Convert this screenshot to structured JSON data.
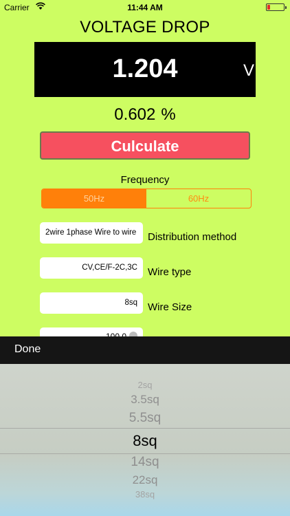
{
  "status_bar": {
    "carrier": "Carrier",
    "time": "11:44 AM"
  },
  "title": "VOLTAGE DROP",
  "display": {
    "value": "1.204",
    "unit": "V"
  },
  "percent": {
    "value": "0.602",
    "unit": "%"
  },
  "calculate_label": "Culculate",
  "frequency": {
    "label": "Frequency",
    "options": [
      "50Hz",
      "60Hz"
    ],
    "selected": "50Hz"
  },
  "distribution": {
    "value": "2wire 1phase Wire to wire",
    "label": "Distribution method"
  },
  "wire_type": {
    "value": "CV,CE/F-2C,3C",
    "label": "Wire type"
  },
  "wire_size": {
    "value": "8sq",
    "label": "Wire Size"
  },
  "length_value": "100.0",
  "toolbar": {
    "done_label": "Done"
  },
  "picker": {
    "options": [
      "2sq",
      "3.5sq",
      "5.5sq",
      "8sq",
      "14sq",
      "22sq",
      "38sq"
    ],
    "selected": "8sq"
  },
  "colors": {
    "background": "#cdfd62",
    "calculate": "#f6505f",
    "segment_accent": "#ff800a"
  }
}
